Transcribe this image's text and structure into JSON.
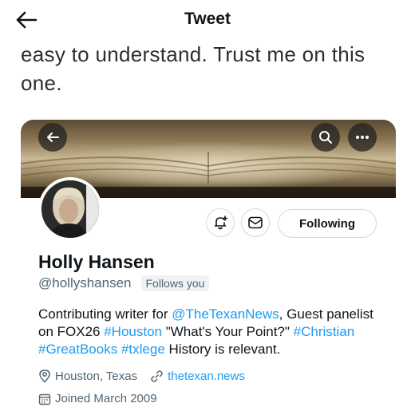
{
  "header": {
    "title": "Tweet",
    "back_icon": "arrow-left-icon"
  },
  "tweet": {
    "text": "easy to understand. Trust me on this one."
  },
  "profile_card": {
    "banner_buttons": [
      "back-arrow-icon",
      "search-icon",
      "more-icon"
    ],
    "actions": {
      "notify_icon": "bell-plus-icon",
      "message_icon": "mail-icon",
      "following_label": "Following"
    },
    "name": "Holly Hansen",
    "handle": "@hollyshansen",
    "follows_you": "Follows you",
    "bio": {
      "p1": "Contributing writer for ",
      "link1": "@TheTexanNews",
      "p2": ", Guest panelist on FOX26 ",
      "link2": "#Houston",
      "p3": " \"What's Your Point?\" ",
      "link3": "#Christian",
      "sp1": " ",
      "link4": "#GreatBooks",
      "sp2": " ",
      "link5": "#txlege",
      "p4": " History is relevant."
    },
    "location": "Houston, Texas",
    "website": "thetexan.news",
    "joined": "Joined March 2009"
  },
  "colors": {
    "link": "#1d9bf0",
    "secondary_text": "#536471",
    "border": "#cfd9de"
  }
}
